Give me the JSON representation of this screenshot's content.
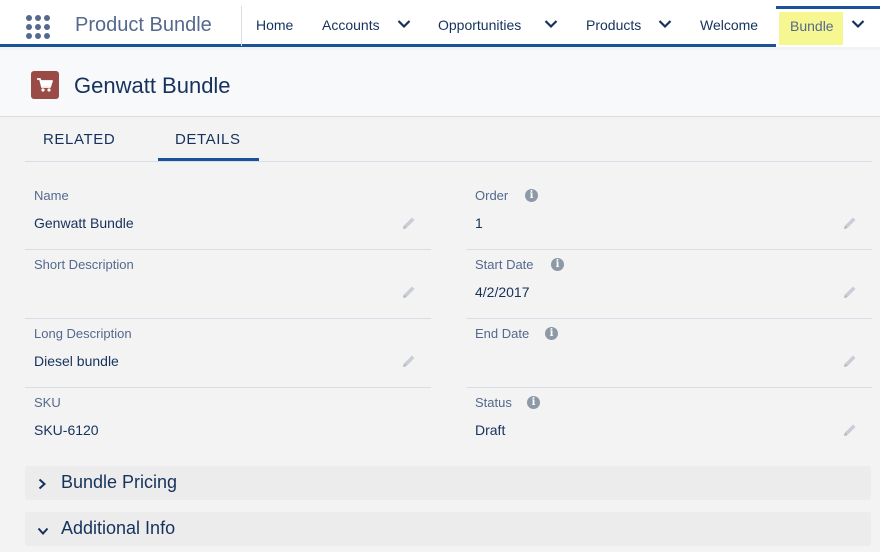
{
  "nav": {
    "app_name": "Product Bundle",
    "items": [
      {
        "label": "Home"
      },
      {
        "label": "Accounts"
      },
      {
        "label": "Opportunities"
      },
      {
        "label": "Products"
      },
      {
        "label": "Welcome"
      },
      {
        "label": "Bundle"
      }
    ]
  },
  "record": {
    "icon": "cart-icon",
    "title": "Genwatt Bundle"
  },
  "tabs": [
    {
      "label": "RELATED"
    },
    {
      "label": "DETAILS"
    }
  ],
  "active_tab": "DETAILS",
  "fields": {
    "left": [
      {
        "label": "Name",
        "value": "Genwatt Bundle"
      },
      {
        "label": "Short Description",
        "value": ""
      },
      {
        "label": "Long Description",
        "value": "Diesel bundle"
      },
      {
        "label": "SKU",
        "value": "SKU-6120"
      }
    ],
    "right": [
      {
        "label": "Order",
        "value": "1"
      },
      {
        "label": "Start Date",
        "value": "4/2/2017"
      },
      {
        "label": "End Date",
        "value": ""
      },
      {
        "label": "Status",
        "value": "Draft"
      }
    ]
  },
  "sections": [
    {
      "title": "Bundle Pricing",
      "expanded": false
    },
    {
      "title": "Additional Info",
      "expanded": true
    }
  ],
  "colors": {
    "brand": "#1b5297",
    "highlight": "#f7f791",
    "record_icon_bg": "#9b4b46"
  }
}
